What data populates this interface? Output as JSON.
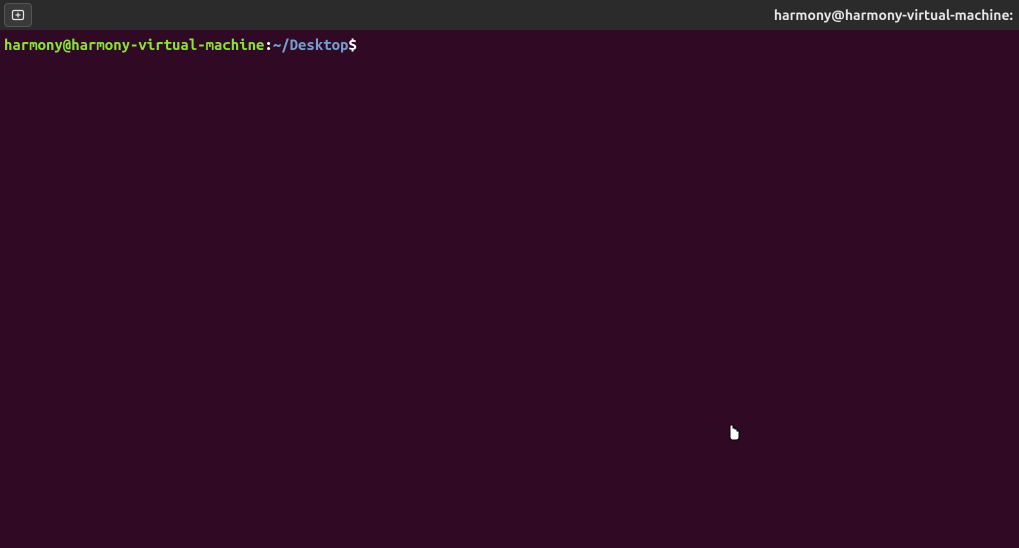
{
  "titlebar": {
    "window_title": "harmony@harmony-virtual-machine:"
  },
  "prompt": {
    "user_host": "harmony@harmony-virtual-machine",
    "separator": ":",
    "path": "~/Desktop",
    "symbol": "$",
    "input_value": ""
  }
}
